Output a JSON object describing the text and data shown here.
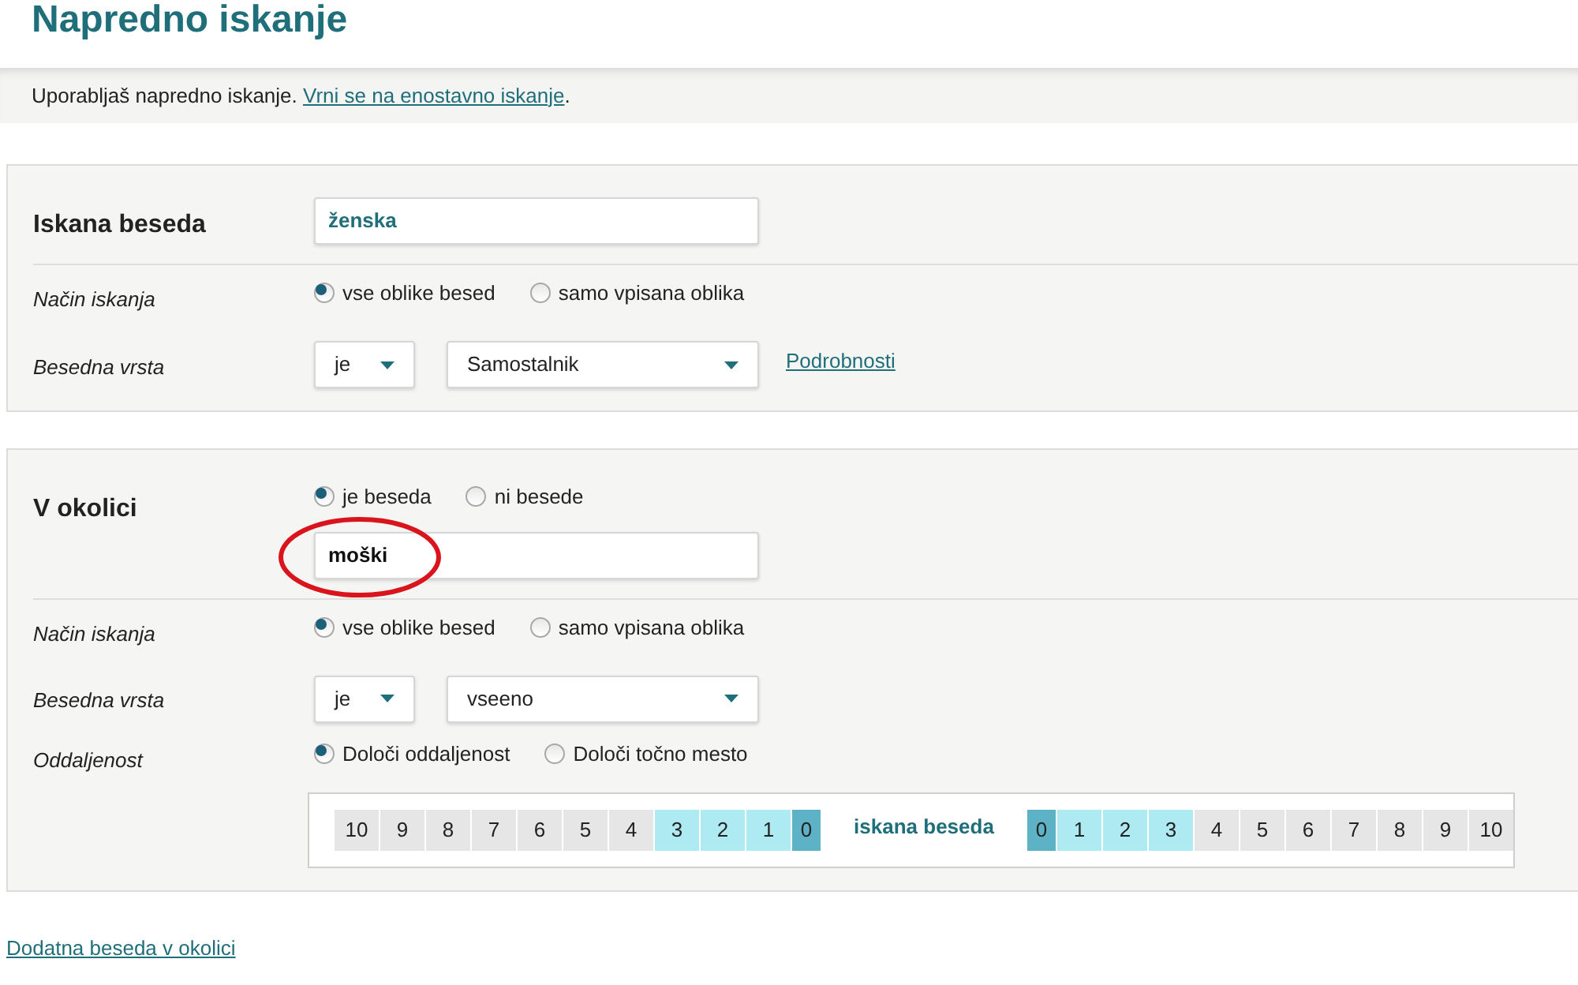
{
  "title": "Napredno iskanje",
  "notice": {
    "text": "Uporabljaš napredno iskanje.",
    "link": "Vrni se na enostavno iskanje",
    "after": "."
  },
  "panels": [
    {
      "heading": "Iskana beseda",
      "field": {
        "value": "ženska",
        "kind": "target"
      },
      "rows": [
        {
          "kind": "radio",
          "label": "Način iskanja",
          "options": [
            {
              "label": "vse oblike besed",
              "selected": true
            },
            {
              "label": "samo vpisana oblika",
              "selected": false
            }
          ]
        },
        {
          "kind": "select",
          "label": "Besedna vrsta",
          "operator": "je",
          "value": "Samostalnik",
          "link": "Podrobnosti"
        }
      ]
    },
    {
      "heading": "V okolici",
      "heading_options": [
        {
          "label": "je beseda",
          "selected": true
        },
        {
          "label": "ni besede",
          "selected": false
        }
      ],
      "field": {
        "value": "moški",
        "kind": "context",
        "circled": true
      },
      "rows": [
        {
          "kind": "radio",
          "label": "Način iskanja",
          "options": [
            {
              "label": "vse oblike besed",
              "selected": true
            },
            {
              "label": "samo vpisana oblika",
              "selected": false
            }
          ]
        },
        {
          "kind": "select",
          "label": "Besedna vrsta",
          "operator": "je",
          "value": "vseeno"
        },
        {
          "kind": "radio",
          "label": "Oddaljenost",
          "options": [
            {
              "label": "Določi oddaljenost",
              "selected": true
            },
            {
              "label": "Določi točno mesto",
              "selected": false
            }
          ]
        },
        {
          "kind": "distance",
          "center": "iskana beseda",
          "left": [
            {
              "label": "10",
              "kind": "step",
              "selected": false
            },
            {
              "label": "9",
              "kind": "step",
              "selected": false
            },
            {
              "label": "8",
              "kind": "step",
              "selected": false
            },
            {
              "label": "7",
              "kind": "step",
              "selected": false
            },
            {
              "label": "6",
              "kind": "step",
              "selected": false
            },
            {
              "label": "5",
              "kind": "step",
              "selected": false
            },
            {
              "label": "4",
              "kind": "step",
              "selected": false
            },
            {
              "label": "3",
              "kind": "step",
              "selected": true
            },
            {
              "label": "2",
              "kind": "step",
              "selected": true
            },
            {
              "label": "1",
              "kind": "step",
              "selected": true
            },
            {
              "label": "0",
              "kind": "origin"
            }
          ],
          "right": [
            {
              "label": "0",
              "kind": "origin"
            },
            {
              "label": "1",
              "kind": "step",
              "selected": true
            },
            {
              "label": "2",
              "kind": "step",
              "selected": true
            },
            {
              "label": "3",
              "kind": "step",
              "selected": true
            },
            {
              "label": "4",
              "kind": "step",
              "selected": false
            },
            {
              "label": "5",
              "kind": "step",
              "selected": false
            },
            {
              "label": "6",
              "kind": "step",
              "selected": false
            },
            {
              "label": "7",
              "kind": "step",
              "selected": false
            },
            {
              "label": "8",
              "kind": "step",
              "selected": false
            },
            {
              "label": "9",
              "kind": "step",
              "selected": false
            },
            {
              "label": "10",
              "kind": "step",
              "selected": false
            }
          ]
        }
      ]
    }
  ],
  "footer_link": "Dodatna beseda v okolici"
}
